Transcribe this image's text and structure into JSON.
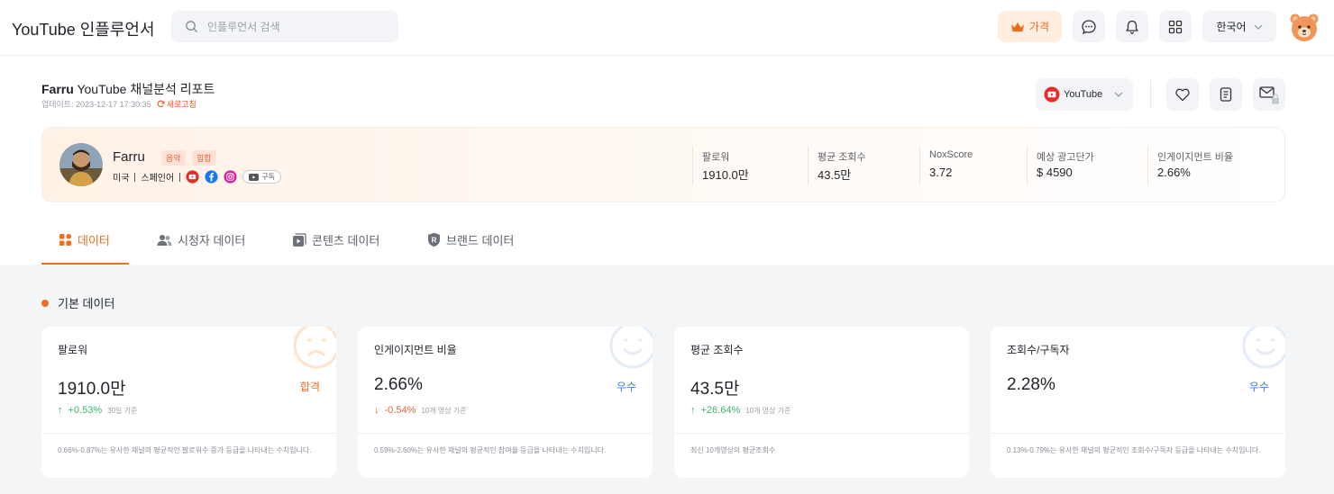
{
  "app": {
    "title": "YouTube 인플루언서"
  },
  "search": {
    "placeholder": "인플루언서 검색"
  },
  "nav": {
    "price_label": "가격",
    "language": "한국어",
    "icons": [
      "chat-icon",
      "bell-icon",
      "apps-grid-icon"
    ]
  },
  "report": {
    "channel": "Farru",
    "title_suffix": "YouTube 채널분석 리포트",
    "updated": "업데이트: 2023-12-17 17:30:35",
    "refresh_label": "새로고침",
    "platform": "YouTube"
  },
  "profile": {
    "name": "Farru",
    "tags": [
      "음악",
      "힙합"
    ],
    "country": "미국",
    "language": "스페인어",
    "subscribe_label": "구독",
    "social": [
      "youtube-icon",
      "facebook-icon",
      "instagram-icon"
    ],
    "stats": [
      {
        "label": "팔로워",
        "value": "1910.0만"
      },
      {
        "label": "평균 조회수",
        "value": "43.5만"
      },
      {
        "label": "NoxScore",
        "value": "3.72"
      },
      {
        "label": "예상 광고단가",
        "value": "$ 4590"
      },
      {
        "label": "인게이지먼트 비율",
        "value": "2.66%"
      }
    ]
  },
  "tabs": [
    {
      "label": "데이터",
      "active": true
    },
    {
      "label": "시청자 데이터",
      "active": false
    },
    {
      "label": "콘텐츠 데이터",
      "active": false
    },
    {
      "label": "브랜드 데이터",
      "active": false
    }
  ],
  "section": {
    "title": "기본 데이터"
  },
  "cards": [
    {
      "label": "팔로워",
      "value": "1910.0만",
      "grade": "합격",
      "grade_color": "#f26b1d",
      "change": "+0.53%",
      "direction": "up",
      "basis": "30일 기준",
      "note": "0.66%-0.87%는 유사한 채널의 평균적인 팔로워수 증가 등급을 나타내는 수치입니다.",
      "face": "sad"
    },
    {
      "label": "인게이지먼트 비율",
      "value": "2.66%",
      "grade": "우수",
      "grade_color": "#3b7ddd",
      "change": "-0.54%",
      "direction": "down",
      "basis": "10개 영상 기준",
      "note": "0.59%-2.60%는 유사한 채널의 평균적인 참여율 등급을 나타내는 수치입니다.",
      "face": "happy"
    },
    {
      "label": "평균 조회수",
      "value": "43.5만",
      "grade": "",
      "grade_color": "#3b7ddd",
      "change": "+26.64%",
      "direction": "up",
      "basis": "10개 영상 기준",
      "note": "최신 10개영상의 평균조회수",
      "face": "none"
    },
    {
      "label": "조회수/구독자",
      "value": "2.28%",
      "grade": "우수",
      "grade_color": "#3b7ddd",
      "change": "",
      "direction": "",
      "basis": "",
      "note": "0.13%-0.79%는 유사한 채널의 평균적인 조회수/구독자 등급을 나타내는 수치입니다.",
      "face": "happy"
    }
  ]
}
